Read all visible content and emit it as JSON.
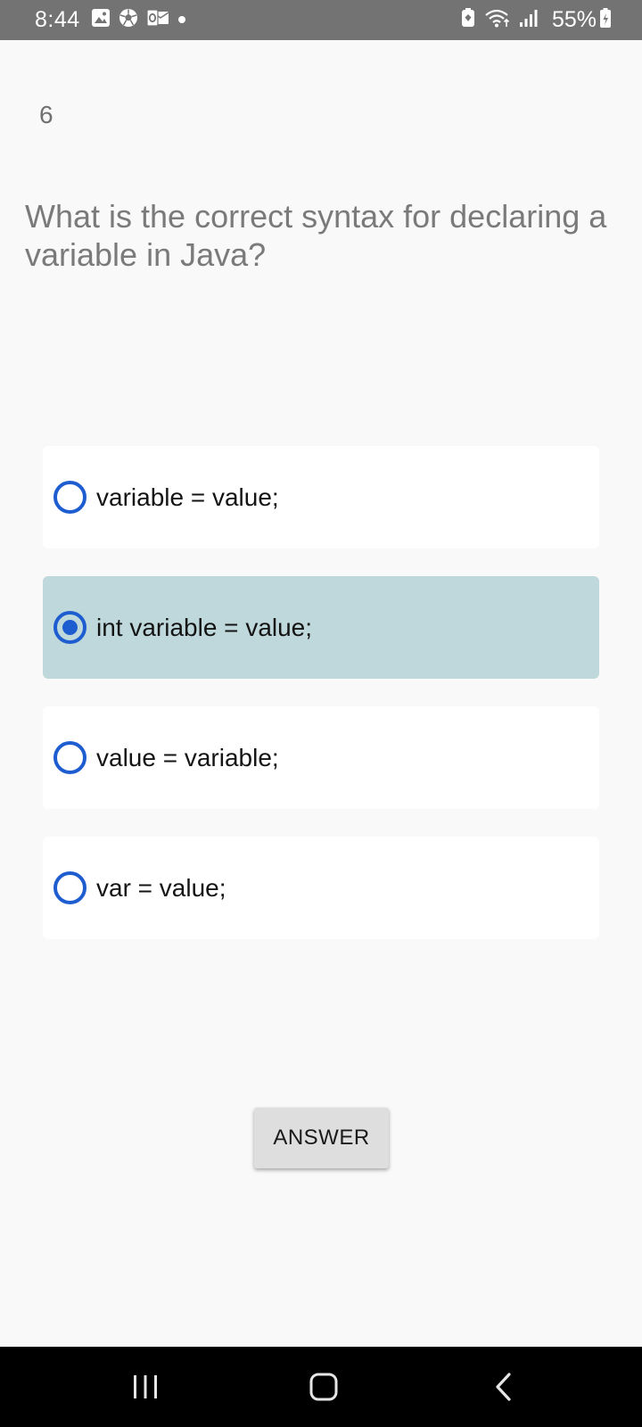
{
  "status_bar": {
    "time": "8:44",
    "battery": "55%",
    "icons": [
      "gallery-icon",
      "soccer-icon",
      "outlook-icon",
      "dot-icon",
      "battery-saver-icon",
      "wifi-icon",
      "signal-icon",
      "battery-icon"
    ]
  },
  "quiz": {
    "question_number": "6",
    "question": "What is the correct syntax for declaring a variable in Java?",
    "options": [
      {
        "label": "variable = value;",
        "selected": false
      },
      {
        "label": "int variable = value;",
        "selected": true
      },
      {
        "label": "value = variable;",
        "selected": false
      },
      {
        "label": "var = value;",
        "selected": false
      }
    ],
    "answer_button": "ANSWER"
  },
  "nav_bar": {
    "icons": [
      "recents-icon",
      "home-icon",
      "back-icon"
    ]
  },
  "colors": {
    "status_bar_bg": "#737373",
    "background": "#f9f9f9",
    "selected_option_bg": "#bfd8dc",
    "radio_accent": "#1e5dd0",
    "nav_bar_bg": "#000000"
  }
}
